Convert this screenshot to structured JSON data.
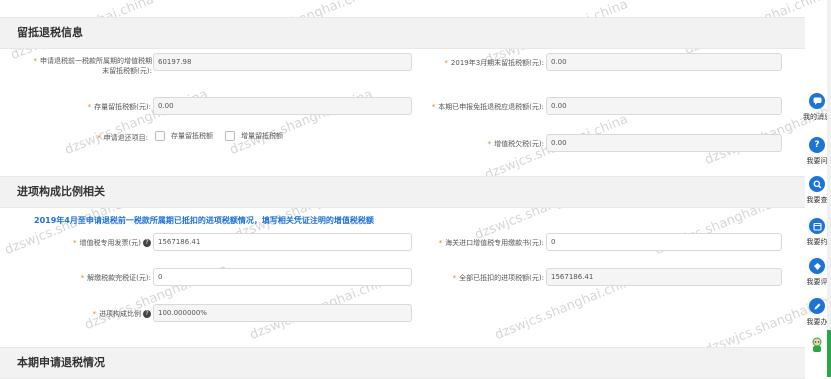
{
  "watermark": "dzswjcs.shanghai.china",
  "section1": {
    "title": "留抵退税信息",
    "field1_label_line1": "申请退税前一税款所属期的增值税期",
    "field1_label_line2": "末留抵税额(元):",
    "field1_value": "60197.98",
    "field2_label": "2019年3月期末留抵税额(元):",
    "field2_value": "0.00",
    "field3_label": "存量留抵税额(元):",
    "field3_value": "0.00",
    "field4_label": "本期已申报免抵退税应退税额(元):",
    "field4_value": "0.00",
    "refund_item_label": "申请退还项目:",
    "option1": "存量留抵税额",
    "option2": "增量留抵税额",
    "field6_label": "增值税欠税(元):",
    "field6_value": "0.00"
  },
  "section2": {
    "title": "进项构成比例相关",
    "notice": "2019年4月至申请退税前一税款所属期已抵扣的进项税额情况，填写相关凭证注明的增值税税额",
    "field1_label": "增值税专用发票(元)",
    "field1_value": "1567186.41",
    "field2_label": "海关进口增值税专用缴款书(元):",
    "field2_value": "0",
    "field3_label": "解缴税款完税证(元):",
    "field3_value": "0",
    "field4_label": "全部已抵扣的进项税额(元):",
    "field4_value": "1567186.41",
    "field5_label": "进项构成比例",
    "field5_value": "100.000000%"
  },
  "section3": {
    "title": "本期申请退税情况"
  },
  "rail": {
    "items": [
      {
        "label": "我的消息",
        "icon": "message-icon"
      },
      {
        "label": "我要问",
        "icon": "question-icon"
      },
      {
        "label": "我要查",
        "icon": "search-icon"
      },
      {
        "label": "我要约",
        "icon": "calendar-icon"
      },
      {
        "label": "我要评",
        "icon": "rate-icon"
      },
      {
        "label": "我要办",
        "icon": "edit-icon"
      }
    ]
  },
  "colors": {
    "accent": "#1d74d8",
    "required": "#ff7a00",
    "section_bg": "#f2f2f2",
    "scroll_thumb": "#2aa745"
  }
}
